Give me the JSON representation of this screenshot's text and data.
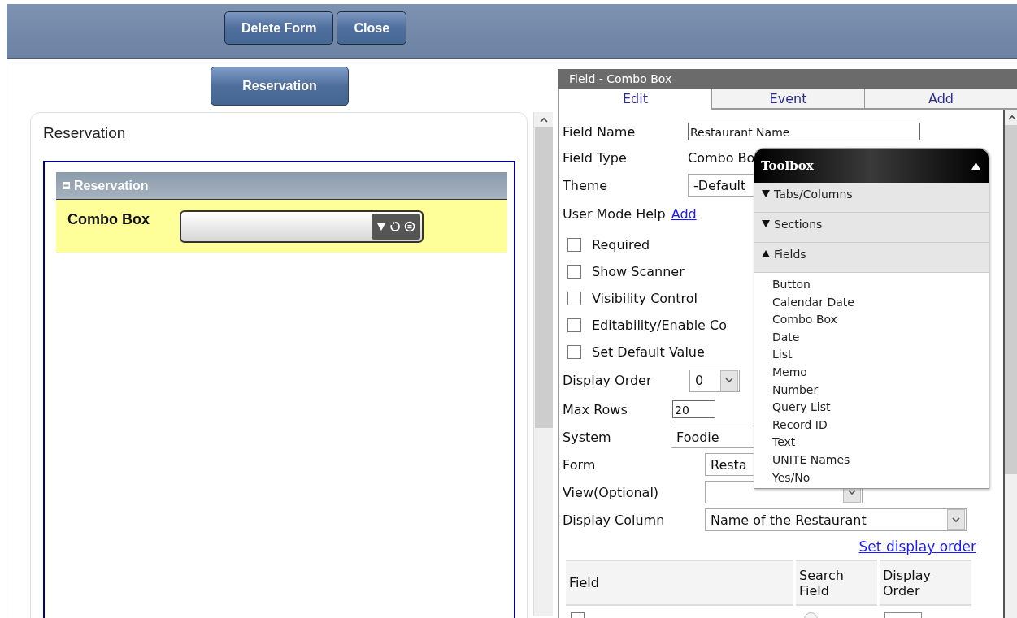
{
  "header_buttons": [
    {
      "label": "Delete Form"
    },
    {
      "label": "Close"
    }
  ],
  "form_button": {
    "label": "Reservation"
  },
  "form_card": {
    "title": "Reservation",
    "section": {
      "title": "Reservation",
      "expanded": true,
      "fields": [
        {
          "label": "Combo Box",
          "kind": "combo"
        }
      ]
    }
  },
  "field_panel": {
    "title": "Field - Combo Box",
    "tabs": [
      {
        "label": "Edit",
        "selected": true
      },
      {
        "label": "Event",
        "selected": false
      },
      {
        "label": "Add",
        "selected": false
      }
    ],
    "top_rows": [
      {
        "label": "Field Name",
        "kind": "input",
        "value": "Restaurant Name"
      },
      {
        "label": "Field Type",
        "kind": "text",
        "value": "Combo Bo"
      },
      {
        "label": "Theme",
        "kind": "select",
        "value": "-Default"
      },
      {
        "label": "User Mode Help",
        "kind": "link",
        "value": "Add"
      }
    ],
    "options": [
      {
        "label": "Required",
        "checked": false
      },
      {
        "label": "Show Scanner",
        "checked": false
      },
      {
        "label": "Visibility Control",
        "checked": false
      },
      {
        "label": "Editability/Enable Co",
        "checked": false
      },
      {
        "label": "Set Default Value",
        "checked": false
      }
    ],
    "bottom_rows": [
      {
        "label": "Display Order",
        "kind": "select",
        "value": "0"
      },
      {
        "label": "Max Rows",
        "kind": "input",
        "value": "20"
      },
      {
        "label": "System",
        "kind": "select",
        "value": "Foodie"
      },
      {
        "label": "Form",
        "kind": "select",
        "value": "Resta"
      },
      {
        "label": "View(Optional)",
        "kind": "select"
      },
      {
        "label": "Display Column",
        "kind": "select",
        "value": "Name of the Restaurant"
      }
    ],
    "set_display_order": "Set display order",
    "table": {
      "columns": [
        "Field",
        "Search Field",
        "Display Order"
      ],
      "rows": [
        {
          "checked": false,
          "search_field": false
        }
      ]
    }
  },
  "toolbox": {
    "title": "Toolbox",
    "expanded": true,
    "groups": [
      {
        "label": "Tabs/Columns",
        "expanded": false
      },
      {
        "label": "Sections",
        "expanded": false
      },
      {
        "label": "Fields",
        "expanded": true,
        "items": [
          "Button",
          "Calendar Date",
          "Combo Box",
          "Date",
          "List",
          "Memo",
          "Number",
          "Query List",
          "Record ID",
          "Text",
          "UNITE Names",
          "Yes/No"
        ]
      }
    ]
  }
}
